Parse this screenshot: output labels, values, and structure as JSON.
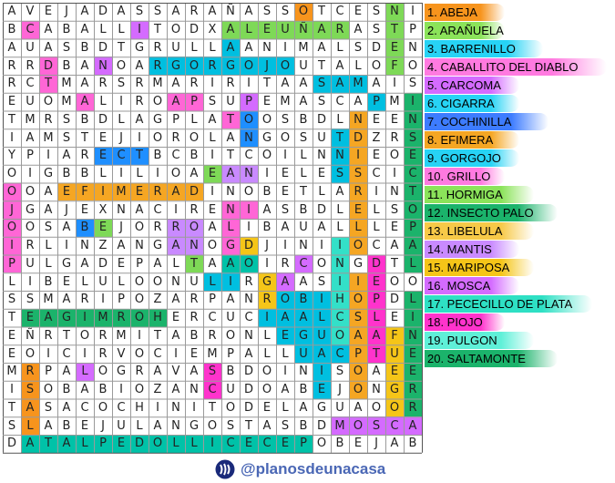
{
  "puzzle": {
    "grid_rows": [
      "AVEJADASSARAÑASSOTCESNI",
      "BCABALLITODXALEUÑARASTP",
      "AUASBDTGRULLAANIMALSDEN",
      "RRDBANOARGORGOJOUTALOFO",
      "RCTMARSRMARIRITAASAMAIS",
      "EUOMALIROAPSUPEMASCAPMI",
      "TMRSBDLAGPLATOOSBDLNEEN",
      "IAMSTEJIOROLANGOSUTDZRS",
      "YPIARECTBCBITCOILNNIEOE",
      "OIGBBLILIOAEANIELESSCIC",
      "OOAEFIMERADINOBETLARINT",
      "JGAJEXNACIRENIASBDLELSO",
      "OOSABEJORROALIBAUALLLEP",
      "IRLINZANGANOGDJINIIOCAA",
      "PULGADEPALTAAOIRCONGDTL",
      "LIBELULOONULIRGAASIIEOO",
      "SSMARIPOZARPANROBIHOPDL",
      "TEAGIMROHERCUCIAALCSLEI",
      "EÑRTORMITABRONLEGUOAAFN",
      "EOICIRVOCIEMPALLUACPTUE",
      "MRPALOGRAVASBDOINISOAEE",
      "ISOBABIOZANCUDOABEJONGR",
      "TASACOCHINITODELAGUAOOR",
      "SLABEJULANGOSTASBDMOSCA",
      "DATALPEDOLLICECEPOBEJAB"
    ],
    "highlights": [
      {
        "word": 1,
        "color": "#f7941d",
        "cells": [
          [
            0,
            16
          ]
        ]
      },
      {
        "word": 2,
        "color": "#7ed957",
        "cells": [
          [
            1,
            12
          ],
          [
            1,
            13
          ],
          [
            1,
            14
          ],
          [
            1,
            15
          ],
          [
            1,
            16
          ],
          [
            1,
            17
          ],
          [
            1,
            18
          ]
        ]
      },
      {
        "word": 3,
        "color": "#00bfe0",
        "cells": [
          [
            2,
            12
          ],
          [
            3,
            8
          ],
          [
            7,
            18
          ],
          [
            8,
            18
          ],
          [
            9,
            18
          ]
        ]
      },
      {
        "word": 4,
        "color": "#ff66d6",
        "cells": [
          [
            1,
            1
          ],
          [
            3,
            2
          ],
          [
            5,
            4
          ]
        ]
      },
      {
        "word": 5,
        "color": "#d46bff",
        "cells": [
          [
            1,
            7
          ],
          [
            3,
            5
          ],
          [
            5,
            13
          ]
        ]
      },
      {
        "word": 6,
        "color": "#00bfe0",
        "cells": [
          [
            3,
            8
          ],
          [
            3,
            9
          ],
          [
            3,
            10
          ],
          [
            3,
            11
          ],
          [
            3,
            12
          ],
          [
            3,
            13
          ],
          [
            3,
            14
          ],
          [
            3,
            15
          ],
          [
            4,
            17
          ],
          [
            4,
            18
          ],
          [
            4,
            19
          ],
          [
            5,
            20
          ]
        ]
      },
      {
        "word": 7,
        "color": "#1f8fff",
        "cells": [
          [
            6,
            13
          ],
          [
            7,
            13
          ],
          [
            8,
            5
          ],
          [
            8,
            6
          ],
          [
            8,
            7
          ],
          [
            12,
            4
          ]
        ]
      },
      {
        "word": 8,
        "color": "#f5a623",
        "cells": [
          [
            10,
            3
          ],
          [
            10,
            4
          ],
          [
            10,
            5
          ],
          [
            10,
            6
          ],
          [
            10,
            7
          ],
          [
            10,
            8
          ],
          [
            10,
            9
          ],
          [
            10,
            10
          ]
        ]
      },
      {
        "word": 9,
        "color": "#ff66d6",
        "cells": [
          [
            10,
            0
          ],
          [
            11,
            0
          ],
          [
            12,
            0
          ],
          [
            13,
            0
          ],
          [
            14,
            0
          ]
        ]
      },
      {
        "word": 10,
        "color": "#ff66d6",
        "cells": [
          [
            4,
            2
          ],
          [
            5,
            9
          ],
          [
            5,
            10
          ],
          [
            6,
            12
          ],
          [
            11,
            13
          ]
        ]
      },
      {
        "word": 11,
        "color": "#7ed957",
        "cells": [
          [
            9,
            11
          ],
          [
            12,
            5
          ],
          [
            14,
            10
          ]
        ]
      },
      {
        "word": 12,
        "color": "#1bb36b",
        "cells": [
          [
            5,
            22
          ],
          [
            6,
            22
          ],
          [
            7,
            22
          ],
          [
            8,
            22
          ],
          [
            9,
            22
          ],
          [
            10,
            22
          ],
          [
            11,
            22
          ],
          [
            12,
            22
          ],
          [
            13,
            22
          ],
          [
            14,
            22
          ],
          [
            16,
            22
          ],
          [
            17,
            22
          ],
          [
            18,
            22
          ],
          [
            19,
            22
          ],
          [
            20,
            22
          ],
          [
            21,
            22
          ],
          [
            22,
            22
          ]
        ]
      },
      {
        "word": 13,
        "color": "#f5a623",
        "cells": [
          [
            6,
            19
          ],
          [
            7,
            19
          ],
          [
            8,
            19
          ],
          [
            9,
            19
          ],
          [
            10,
            19
          ],
          [
            11,
            19
          ],
          [
            12,
            19
          ],
          [
            13,
            19
          ],
          [
            15,
            19
          ],
          [
            16,
            19
          ],
          [
            17,
            19
          ],
          [
            18,
            19
          ],
          [
            19,
            19
          ],
          [
            20,
            19
          ],
          [
            21,
            19
          ]
        ]
      },
      {
        "word": 14,
        "color": "#c98aff",
        "cells": [
          [
            9,
            11
          ],
          [
            9,
            12
          ],
          [
            9,
            13
          ],
          [
            12,
            9
          ],
          [
            12,
            10
          ],
          [
            13,
            9
          ],
          [
            13,
            10
          ]
        ]
      },
      {
        "word": 15,
        "color": "#f5c518",
        "cells": [
          [
            13,
            13
          ],
          [
            15,
            14
          ],
          [
            16,
            14
          ]
        ]
      },
      {
        "word": 16,
        "color": "#d46bff",
        "cells": [
          [
            14,
            16
          ],
          [
            15,
            15
          ],
          [
            20,
            4
          ],
          [
            23,
            18
          ],
          [
            23,
            19
          ],
          [
            23,
            20
          ],
          [
            23,
            21
          ],
          [
            23,
            22
          ]
        ]
      },
      {
        "word": 17,
        "color": "#00c2a8",
        "cells": [
          [
            24,
            1
          ],
          [
            24,
            2
          ],
          [
            24,
            3
          ],
          [
            24,
            4
          ],
          [
            24,
            5
          ],
          [
            24,
            6
          ],
          [
            24,
            7
          ],
          [
            24,
            8
          ],
          [
            24,
            9
          ],
          [
            24,
            10
          ],
          [
            24,
            11
          ],
          [
            24,
            12
          ],
          [
            24,
            13
          ],
          [
            24,
            14
          ],
          [
            24,
            15
          ],
          [
            24,
            16
          ],
          [
            14,
            12
          ],
          [
            14,
            13
          ]
        ]
      },
      {
        "word": 18,
        "color": "#ff33cc",
        "cells": [
          [
            14,
            20
          ],
          [
            15,
            20
          ],
          [
            16,
            20
          ],
          [
            17,
            20
          ],
          [
            18,
            20
          ],
          [
            19,
            20
          ],
          [
            20,
            11
          ],
          [
            21,
            11
          ]
        ]
      },
      {
        "word": 19,
        "color": "#33e0c8",
        "cells": [
          [
            13,
            18
          ],
          [
            13,
            19
          ],
          [
            14,
            18
          ],
          [
            15,
            18
          ],
          [
            16,
            18
          ],
          [
            17,
            18
          ],
          [
            18,
            18
          ]
        ]
      },
      {
        "word": 20,
        "color": "#1bb36b",
        "cells": [
          [
            17,
            1
          ],
          [
            17,
            2
          ],
          [
            17,
            3
          ],
          [
            17,
            4
          ],
          [
            17,
            5
          ],
          [
            17,
            6
          ],
          [
            17,
            7
          ],
          [
            17,
            8
          ]
        ]
      },
      {
        "word": 21,
        "color": "#00bfe0",
        "cells": [
          [
            15,
            11
          ],
          [
            15,
            12
          ],
          [
            16,
            15
          ],
          [
            16,
            16
          ],
          [
            16,
            17
          ],
          [
            17,
            14
          ],
          [
            17,
            15
          ],
          [
            17,
            16
          ],
          [
            17,
            17
          ],
          [
            18,
            15
          ],
          [
            18,
            16
          ],
          [
            18,
            17
          ],
          [
            19,
            16
          ],
          [
            19,
            17
          ],
          [
            19,
            18
          ],
          [
            20,
            17
          ],
          [
            21,
            17
          ]
        ]
      },
      {
        "word": 22,
        "color": "#f5c518",
        "cells": [
          [
            16,
            20
          ],
          [
            17,
            20
          ],
          [
            18,
            20
          ],
          [
            18,
            21
          ],
          [
            19,
            21
          ],
          [
            20,
            21
          ],
          [
            21,
            21
          ],
          [
            22,
            21
          ],
          [
            23,
            21
          ]
        ]
      },
      {
        "word": 23,
        "color": "#7ed957",
        "cells": [
          [
            0,
            21
          ],
          [
            1,
            21
          ],
          [
            2,
            21
          ],
          [
            3,
            21
          ]
        ]
      },
      {
        "word": 24,
        "color": "#f7941d",
        "cells": [
          [
            20,
            1
          ],
          [
            21,
            1
          ],
          [
            22,
            1
          ],
          [
            23,
            1
          ],
          [
            24,
            1
          ]
        ]
      },
      {
        "word": 25,
        "color": "#ff66d6",
        "cells": [
          [
            11,
            12
          ],
          [
            12,
            12
          ],
          [
            13,
            12
          ],
          [
            14,
            12
          ],
          [
            15,
            12
          ]
        ]
      }
    ]
  },
  "word_list": [
    {
      "label": "1. ABEJA",
      "color": "#f7941d"
    },
    {
      "label": "2. ARAÑUELA",
      "color": "#8be35a"
    },
    {
      "label": "3. BARRENILLO",
      "color": "#27d3f5"
    },
    {
      "label": "4. CABALLITO DEL DIABLO",
      "color": "#ff7ae0"
    },
    {
      "label": "5. CARCOMA",
      "color": "#d46bff"
    },
    {
      "label": "6. CIGARRA",
      "color": "#27d3f5"
    },
    {
      "label": "7. COCHINILLA",
      "color": "#3d7cff"
    },
    {
      "label": "8. EFIMERA",
      "color": "#f5a623"
    },
    {
      "label": "9. GORGOJO",
      "color": "#27d3f5"
    },
    {
      "label": "10. GRILLO",
      "color": "#ff7ae0"
    },
    {
      "label": "11. HORMIGA",
      "color": "#8be35a"
    },
    {
      "label": "12. INSECTO PALO",
      "color": "#1bb36b"
    },
    {
      "label": "13. LIBELULA",
      "color": "#f7c948"
    },
    {
      "label": "14. MANTIS",
      "color": "#c98aff"
    },
    {
      "label": "15. MARIPOSA",
      "color": "#f5c518"
    },
    {
      "label": "16. MOSCA",
      "color": "#d46bff"
    },
    {
      "label": "17. PECECILLO DE PLATA",
      "color": "#2ee0c4"
    },
    {
      "label": "18. PIOJO",
      "color": "#ff33cc"
    },
    {
      "label": "19. PULGON",
      "color": "#5ff0d8"
    },
    {
      "label": "20. SALTAMONTE",
      "color": "#1bb36b"
    }
  ],
  "footer": {
    "handle": "@planosdeunacasa",
    "icon": "steemit-icon",
    "text_color": "#4a67b5"
  }
}
